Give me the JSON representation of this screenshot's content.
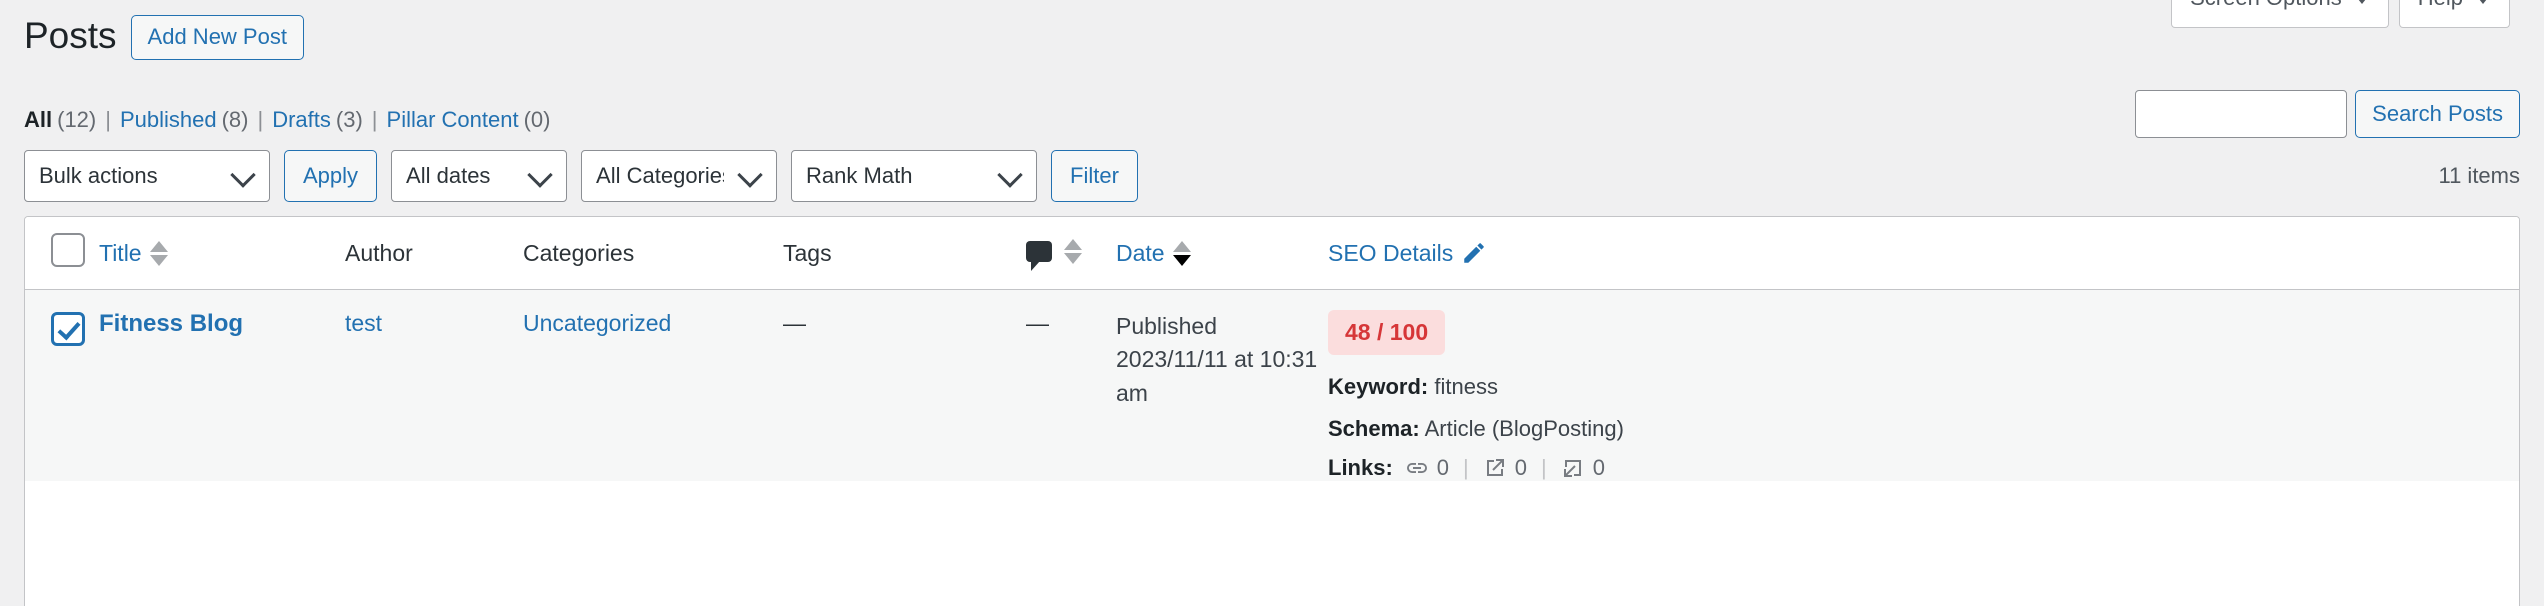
{
  "screen_meta": {
    "screen_options_label": "Screen Options",
    "help_label": "Help"
  },
  "header": {
    "title": "Posts",
    "add_new_label": "Add New Post"
  },
  "search": {
    "value": "",
    "placeholder": "",
    "submit_label": "Search Posts"
  },
  "status_links": [
    {
      "label": "All",
      "count": "(12)",
      "current": true
    },
    {
      "label": "Published",
      "count": "(8)",
      "current": false
    },
    {
      "label": "Drafts",
      "count": "(3)",
      "current": false
    },
    {
      "label": "Pillar Content",
      "count": "(0)",
      "current": false
    }
  ],
  "status_separator": "|",
  "tablenav": {
    "bulk_actions_selected": "Bulk actions",
    "apply_label": "Apply",
    "dates_selected": "All dates",
    "categories_selected": "All Categories",
    "rank_math_selected": "Rank Math",
    "filter_label": "Filter",
    "displaying_num": "11 items"
  },
  "table": {
    "columns": {
      "title": "Title",
      "author": "Author",
      "categories": "Categories",
      "tags": "Tags",
      "comments_icon": "comment-bubble-icon",
      "date": "Date",
      "seo_details": "SEO Details",
      "seo_edit_icon": "pencil-icon"
    },
    "rows": [
      {
        "selected": true,
        "title": "Fitness Blog",
        "author": "test",
        "categories": "Uncategorized",
        "tags": "—",
        "comments": "—",
        "date_status": "Published",
        "date_value": "2023/11/11 at 10:31 am",
        "seo": {
          "score": "48 / 100",
          "keyword_label": "Keyword:",
          "keyword_value": "fitness",
          "schema_label": "Schema:",
          "schema_value": "Article (BlogPosting)",
          "links_label": "Links:",
          "internal_links": "0",
          "external_links": "0",
          "incoming_links": "0",
          "links_separator": "|"
        }
      }
    ]
  },
  "colors": {
    "link": "#2271b1",
    "background": "#f0f0f1",
    "row_background": "#f6f7f7",
    "seo_score_text": "#d63638",
    "seo_score_bg": "#fbdddd"
  }
}
